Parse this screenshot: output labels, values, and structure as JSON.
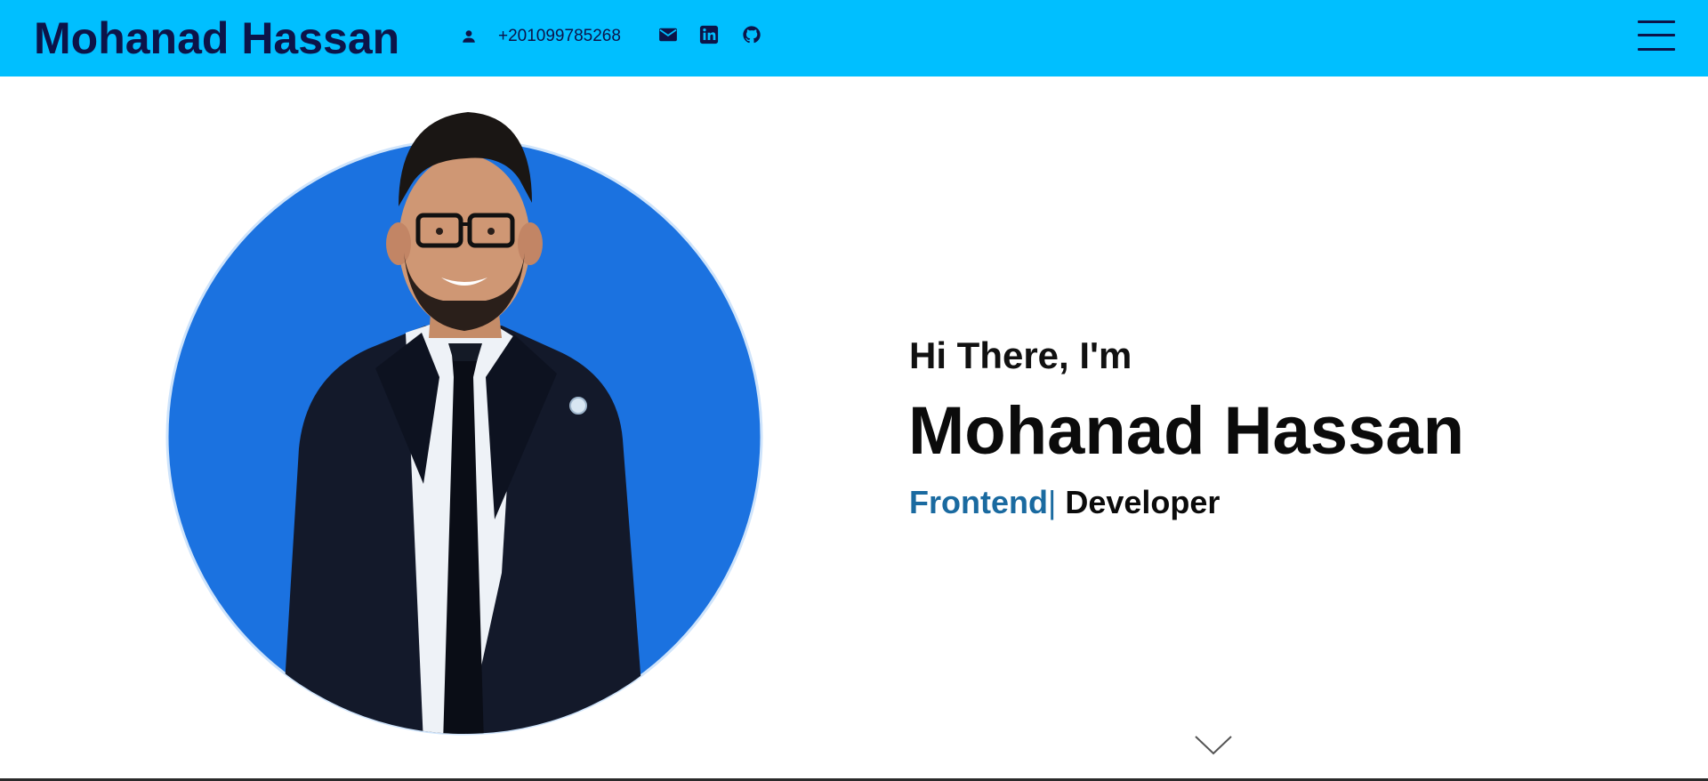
{
  "header": {
    "brand": "Mohanad Hassan",
    "phone": "+201099785268",
    "icons": {
      "person": "person-icon",
      "email": "email-icon",
      "linkedin": "linkedin-icon",
      "github": "github-icon",
      "menu": "hamburger-menu-icon"
    },
    "background_color": "#00bfff",
    "text_color": "#0c1449"
  },
  "hero": {
    "greeting": "Hi There, I'm",
    "name": "Mohanad Hassan",
    "role_typed": "Frontend",
    "role_caret": "|",
    "role_static": " Developer",
    "accent_color": "#1a6aa0",
    "photo_background_color": "#1b72e0",
    "scroll_icon": "chevron-down-icon"
  }
}
